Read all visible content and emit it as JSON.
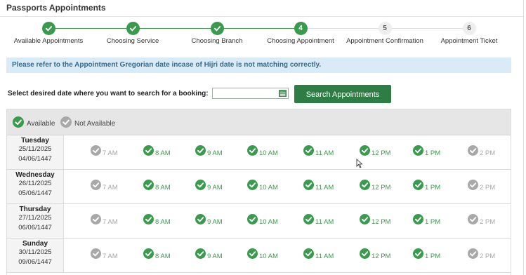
{
  "page": {
    "title": "Passports Appointments",
    "notice": "Please refer to the Appointment Gregorian date incase of Hijri date is not matching correctly."
  },
  "steps": [
    {
      "num": "1",
      "label": "Available Appointments",
      "state": "done"
    },
    {
      "num": "2",
      "label": "Choosing Service",
      "state": "done"
    },
    {
      "num": "3",
      "label": "Choosing Branch",
      "state": "done"
    },
    {
      "num": "4",
      "label": "Choosing Appointment",
      "state": "current"
    },
    {
      "num": "5",
      "label": "Appointment Confirmation",
      "state": "todo"
    },
    {
      "num": "6",
      "label": "Appointment Ticket",
      "state": "todo"
    }
  ],
  "search": {
    "label": "Select desired date where you want to search for a booking:",
    "value": "",
    "button": "Search Appointments"
  },
  "legend": {
    "available": "Available",
    "not_available": "Not Available"
  },
  "colors": {
    "available": "#3a9a4d",
    "not_available": "#a8a8a8",
    "button": "#2e7d44",
    "notice_bg": "#d9ebf7"
  },
  "days": [
    {
      "name": "Tuesday",
      "gregorian": "25/11/2025",
      "hijri": "04/06/1447",
      "slots": [
        {
          "time": "7 AM",
          "available": false
        },
        {
          "time": "8 AM",
          "available": true
        },
        {
          "time": "9 AM",
          "available": true
        },
        {
          "time": "10 AM",
          "available": true
        },
        {
          "time": "11 AM",
          "available": true
        },
        {
          "time": "12 PM",
          "available": true
        },
        {
          "time": "1 PM",
          "available": true
        },
        {
          "time": "2 PM",
          "available": false
        }
      ]
    },
    {
      "name": "Wednesday",
      "gregorian": "26/11/2025",
      "hijri": "05/06/1447",
      "slots": [
        {
          "time": "7 AM",
          "available": false
        },
        {
          "time": "8 AM",
          "available": true
        },
        {
          "time": "9 AM",
          "available": true
        },
        {
          "time": "10 AM",
          "available": true
        },
        {
          "time": "11 AM",
          "available": true
        },
        {
          "time": "12 PM",
          "available": true
        },
        {
          "time": "1 PM",
          "available": true
        },
        {
          "time": "2 PM",
          "available": false
        }
      ]
    },
    {
      "name": "Thursday",
      "gregorian": "27/11/2025",
      "hijri": "06/06/1447",
      "slots": [
        {
          "time": "7 AM",
          "available": false
        },
        {
          "time": "8 AM",
          "available": true
        },
        {
          "time": "9 AM",
          "available": true
        },
        {
          "time": "10 AM",
          "available": true
        },
        {
          "time": "11 AM",
          "available": true
        },
        {
          "time": "12 PM",
          "available": true
        },
        {
          "time": "1 PM",
          "available": true
        },
        {
          "time": "2 PM",
          "available": false
        }
      ]
    },
    {
      "name": "Sunday",
      "gregorian": "30/11/2025",
      "hijri": "09/06/1447",
      "slots": [
        {
          "time": "7 AM",
          "available": false
        },
        {
          "time": "8 AM",
          "available": true
        },
        {
          "time": "9 AM",
          "available": true
        },
        {
          "time": "10 AM",
          "available": true
        },
        {
          "time": "11 AM",
          "available": true
        },
        {
          "time": "12 PM",
          "available": true
        },
        {
          "time": "1 PM",
          "available": true
        },
        {
          "time": "2 PM",
          "available": false
        }
      ]
    }
  ]
}
